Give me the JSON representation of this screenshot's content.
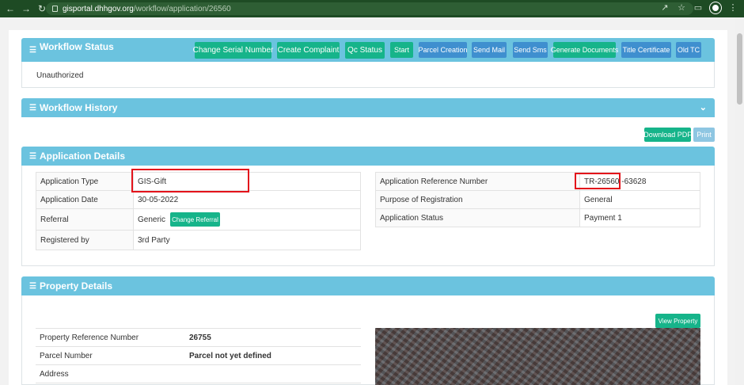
{
  "browser": {
    "url_host": "gisportal.dhhgov.org",
    "url_path": "/workflow/application/26560"
  },
  "workflow_status": {
    "title": "Workflow Status",
    "status_text": "Unauthorized",
    "buttons": {
      "change_serial": "Change Serial Number",
      "create_complaint": "Create Complaint",
      "qc_status": "Qc Status",
      "start": "Start",
      "parcel_creation": "Parcel Creation",
      "send_mail": "Send Mail",
      "send_sms": "Send Sms",
      "generate_documents": "Generate Documents",
      "title_certificate": "Title Certificate",
      "old_tc": "Old TC"
    }
  },
  "workflow_history": {
    "title": "Workflow History"
  },
  "actions": {
    "download_pdf": "Download PDF",
    "print": "Print"
  },
  "application_details": {
    "title": "Application Details",
    "left": [
      {
        "label": "Application Type",
        "value": "GIS-Gift"
      },
      {
        "label": "Application Date",
        "value": "30-05-2022"
      },
      {
        "label": "Referral",
        "value": "Generic"
      },
      {
        "label": "Registered by",
        "value": "3rd Party"
      }
    ],
    "change_referral": "Change Referral",
    "right": [
      {
        "label": "Application Reference Number",
        "value": "TR-26560 -63628"
      },
      {
        "label": "Purpose of Registration",
        "value": "General"
      },
      {
        "label": "Application Status",
        "value": "Payment 1"
      }
    ]
  },
  "property_details": {
    "title": "Property Details",
    "view_property": "View Property",
    "rows": [
      {
        "label": "Property Reference Number",
        "value": "26755"
      },
      {
        "label": "Parcel Number",
        "value": "Parcel not yet defined"
      },
      {
        "label": "Address",
        "value": ""
      }
    ]
  }
}
